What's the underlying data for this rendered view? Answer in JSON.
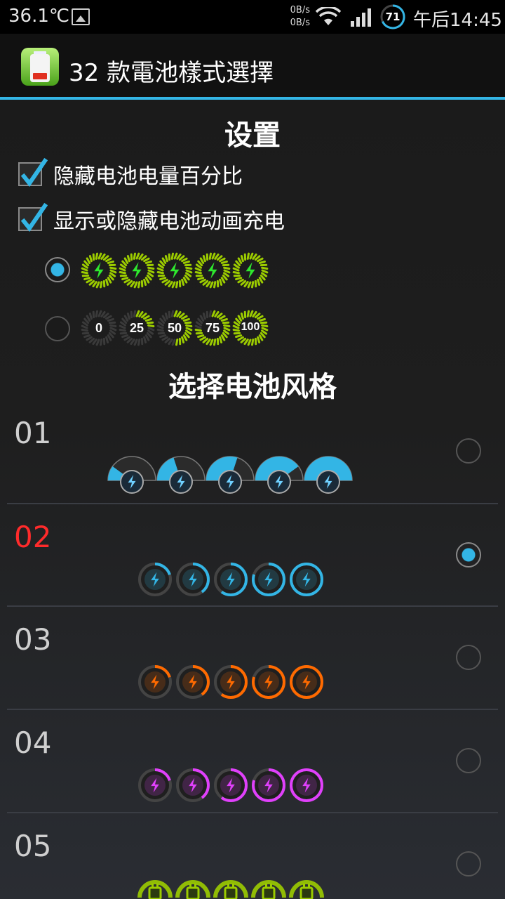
{
  "status_bar": {
    "temperature": "36.1℃",
    "net_up": "0B/s",
    "net_down": "0B/s",
    "battery_level": "71",
    "time": "午后14:45"
  },
  "app": {
    "title": "32 款電池樣式選擇"
  },
  "settings": {
    "heading": "设置",
    "options": [
      {
        "label": "隐藏电池电量百分比",
        "checked": true
      },
      {
        "label": "显示或隐藏电池动画充电",
        "checked": true
      }
    ],
    "charging_styles": [
      {
        "selected": true,
        "icons": [
          "bolt",
          "bolt",
          "bolt",
          "bolt",
          "bolt"
        ]
      },
      {
        "selected": false,
        "labels": [
          "0",
          "25",
          "50",
          "75",
          "100"
        ]
      }
    ]
  },
  "styles": {
    "heading": "选择电池风格",
    "items": [
      {
        "number": "01",
        "selected": false,
        "color": "#33b5e5"
      },
      {
        "number": "02",
        "selected": true,
        "color": "#33b5e5"
      },
      {
        "number": "03",
        "selected": false,
        "color": "#ff6a00"
      },
      {
        "number": "04",
        "selected": false,
        "color": "#e040fb"
      },
      {
        "number": "05",
        "selected": false,
        "color": "#9ccc00"
      }
    ]
  },
  "colors": {
    "accent": "#33b5e5",
    "selected_number": "#ff2b2b",
    "charge_green": "#9ccc00"
  }
}
